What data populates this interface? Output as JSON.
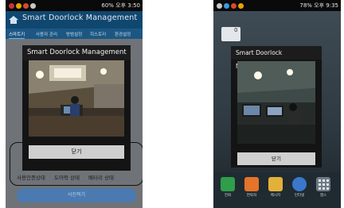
{
  "left_screen": {
    "statusbar": {
      "time": "오후 3:50",
      "battery": "60%"
    },
    "app": {
      "title": "Smart Doorlock Management",
      "tabs": [
        "스마트키",
        "사용자 관리",
        "방범설정",
        "히스토리",
        "환경설정"
      ],
      "bottom_labels": [
        "사용인증상태",
        "도어락 상태",
        "배터리 상태"
      ],
      "bottom_button": "사진찍기"
    },
    "dialog": {
      "title": "Smart Doorlock Management",
      "close_label": "닫기"
    }
  },
  "right_screen": {
    "statusbar": {
      "time": "오후 9:35",
      "battery": "78%"
    },
    "widget_count": "0",
    "dialog": {
      "title": "Smart Doorlock Management",
      "close_label": "닫기"
    },
    "dock": [
      {
        "label": "전화",
        "color": "#2f9d4a",
        "icon": "phone-icon"
      },
      {
        "label": "연락처",
        "color": "#e3742a",
        "icon": "contacts-icon"
      },
      {
        "label": "메시지",
        "color": "#e2b13a",
        "icon": "message-icon"
      },
      {
        "label": "인터넷",
        "color": "#3a78c9",
        "icon": "globe-icon"
      },
      {
        "label": "앱스",
        "color": "#6d7a84",
        "icon": "apps-icon"
      }
    ]
  }
}
